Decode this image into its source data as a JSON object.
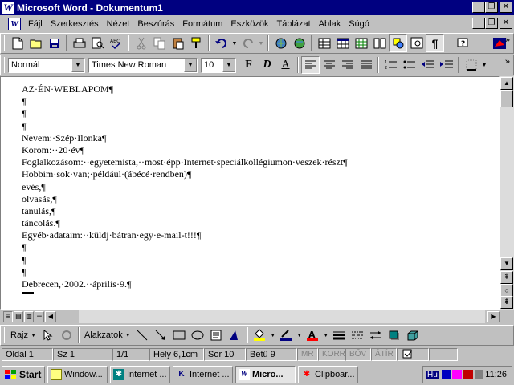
{
  "window": {
    "title": "Microsoft Word - Dokumentum1",
    "app_icon": "W",
    "minimize": "_",
    "restore": "❐",
    "close": "✕"
  },
  "menu": {
    "items": [
      "Fájl",
      "Szerkesztés",
      "Nézet",
      "Beszúrás",
      "Formátum",
      "Eszközök",
      "Táblázat",
      "Ablak",
      "Súgó"
    ]
  },
  "formatting": {
    "style": "Normál",
    "font": "Times New Roman",
    "size": "10",
    "bold": "F",
    "italic": "D",
    "underline": "A"
  },
  "document": {
    "lines": [
      "AZ·ÉN·WEBLAPOM¶",
      "¶",
      "¶",
      "¶",
      "Nevem:·Szép·Ilonka¶",
      "Korom:··20·év¶",
      "Foglalkozásom:··egyetemista,··most·épp·Internet·speciálkollégiumon·veszek·részt¶",
      "Hobbim·sok·van;·például·(ábécé·rendben)¶",
      "evés,¶",
      "olvasás,¶",
      "tanulás,¶",
      "táncolás.¶",
      "Egyéb·adataim:··küldj·bátran·egy·e-mail-t!!!¶",
      "¶",
      "¶",
      "¶",
      "Debrecen,·2002.··április·9.¶"
    ]
  },
  "drawing_toolbar": {
    "draw_label": "Rajz",
    "autoshapes_label": "Alakzatok"
  },
  "status": {
    "page": "Oldal  1",
    "section": "Sz  1",
    "page_of": "1/1",
    "position": "Hely  6,1cm",
    "line": "Sor  10",
    "column": "Betű  9",
    "rec": "MR",
    "trk": "KORR",
    "ext": "BŐV",
    "ovr": "ÁTÍR"
  },
  "taskbar": {
    "start": "Start",
    "buttons": [
      "Window...",
      "Internet ...",
      "Internet ...",
      "Micro...",
      "Clipboar..."
    ],
    "language": "Hu",
    "clock": "11:26"
  },
  "colors": {
    "titlebar": "#000080",
    "face": "#c0c0c0"
  }
}
